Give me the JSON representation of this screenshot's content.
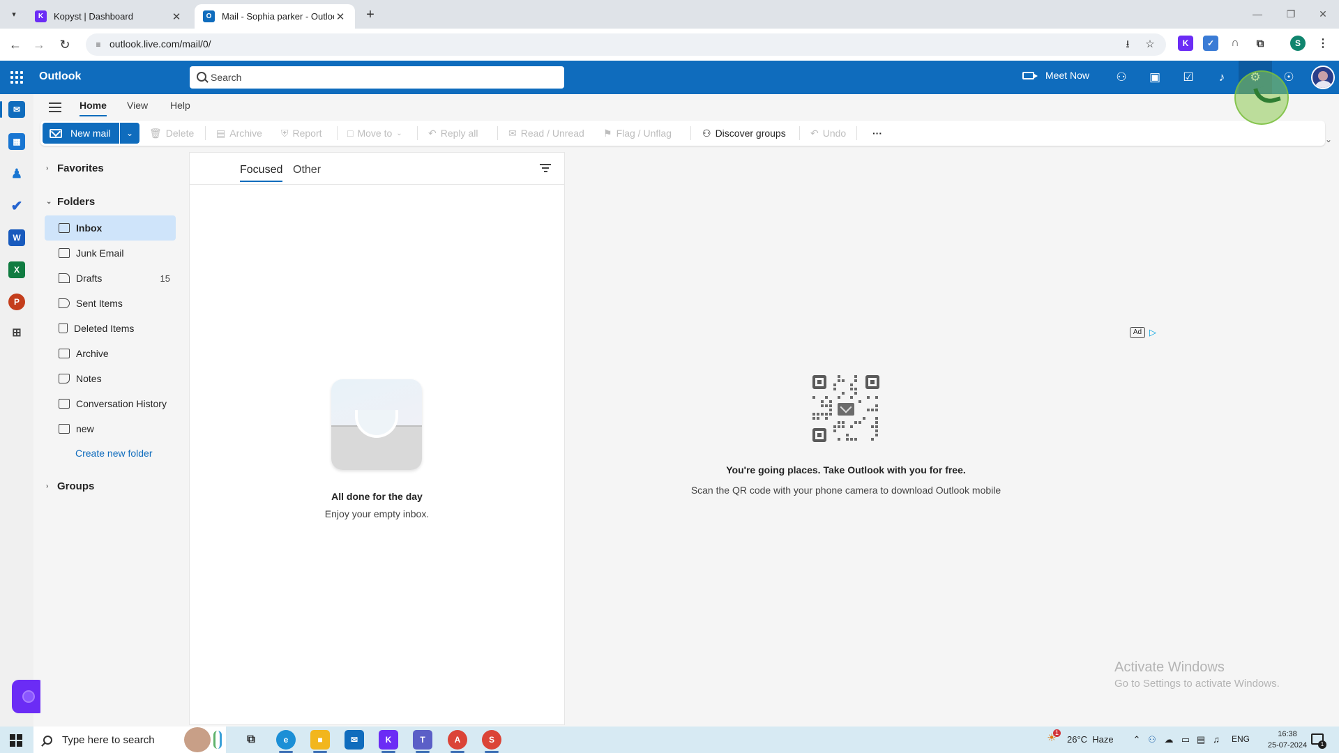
{
  "browser": {
    "tabs": [
      {
        "title": "Kopyst | Dashboard",
        "favicon": "kopyst-logo-icon",
        "active": false
      },
      {
        "title": "Mail - Sophia parker - Outlook",
        "favicon": "outlook-logo-icon",
        "active": true
      }
    ],
    "url": "outlook.live.com/mail/0/",
    "profile_initial": "S"
  },
  "header": {
    "app_name": "Outlook",
    "search_placeholder": "Search",
    "meet_now": "Meet Now",
    "brand_color": "#0f6cbd"
  },
  "ribbon": {
    "tabs": [
      "Home",
      "View",
      "Help"
    ],
    "active_tab": "Home",
    "new_mail": "New mail",
    "actions": {
      "delete": "Delete",
      "archive": "Archive",
      "report": "Report",
      "move_to": "Move to",
      "reply_all": "Reply all",
      "read_unread": "Read / Unread",
      "flag_unflag": "Flag / Unflag",
      "discover_groups": "Discover groups",
      "undo": "Undo",
      "more": "···"
    }
  },
  "folders": {
    "favorites_label": "Favorites",
    "folders_label": "Folders",
    "groups_label": "Groups",
    "items": [
      {
        "label": "Inbox",
        "count": "",
        "selected": true
      },
      {
        "label": "Junk Email",
        "count": ""
      },
      {
        "label": "Drafts",
        "count": "15"
      },
      {
        "label": "Sent Items",
        "count": ""
      },
      {
        "label": "Deleted Items",
        "count": ""
      },
      {
        "label": "Archive",
        "count": ""
      },
      {
        "label": "Notes",
        "count": ""
      },
      {
        "label": "Conversation History",
        "count": ""
      },
      {
        "label": "new",
        "count": ""
      }
    ],
    "create_new": "Create new folder"
  },
  "message_list": {
    "pivots": [
      "Focused",
      "Other"
    ],
    "active_pivot": "Focused",
    "empty_title": "All done for the day",
    "empty_subtitle": "Enjoy your empty inbox."
  },
  "reading_pane": {
    "ad_label": "Ad",
    "promo_title": "You're going places. Take Outlook with you for free.",
    "promo_subtitle": "Scan the QR code with your phone camera to download Outlook mobile"
  },
  "watermark": {
    "title": "Activate Windows",
    "subtitle": "Go to Settings to activate Windows."
  },
  "taskbar": {
    "search_placeholder": "Type here to search",
    "weather": "26°C  Haze",
    "weather_alert": "1",
    "language": "ENG",
    "time": "16:38",
    "date": "25-07-2024",
    "notification_count": "1"
  }
}
